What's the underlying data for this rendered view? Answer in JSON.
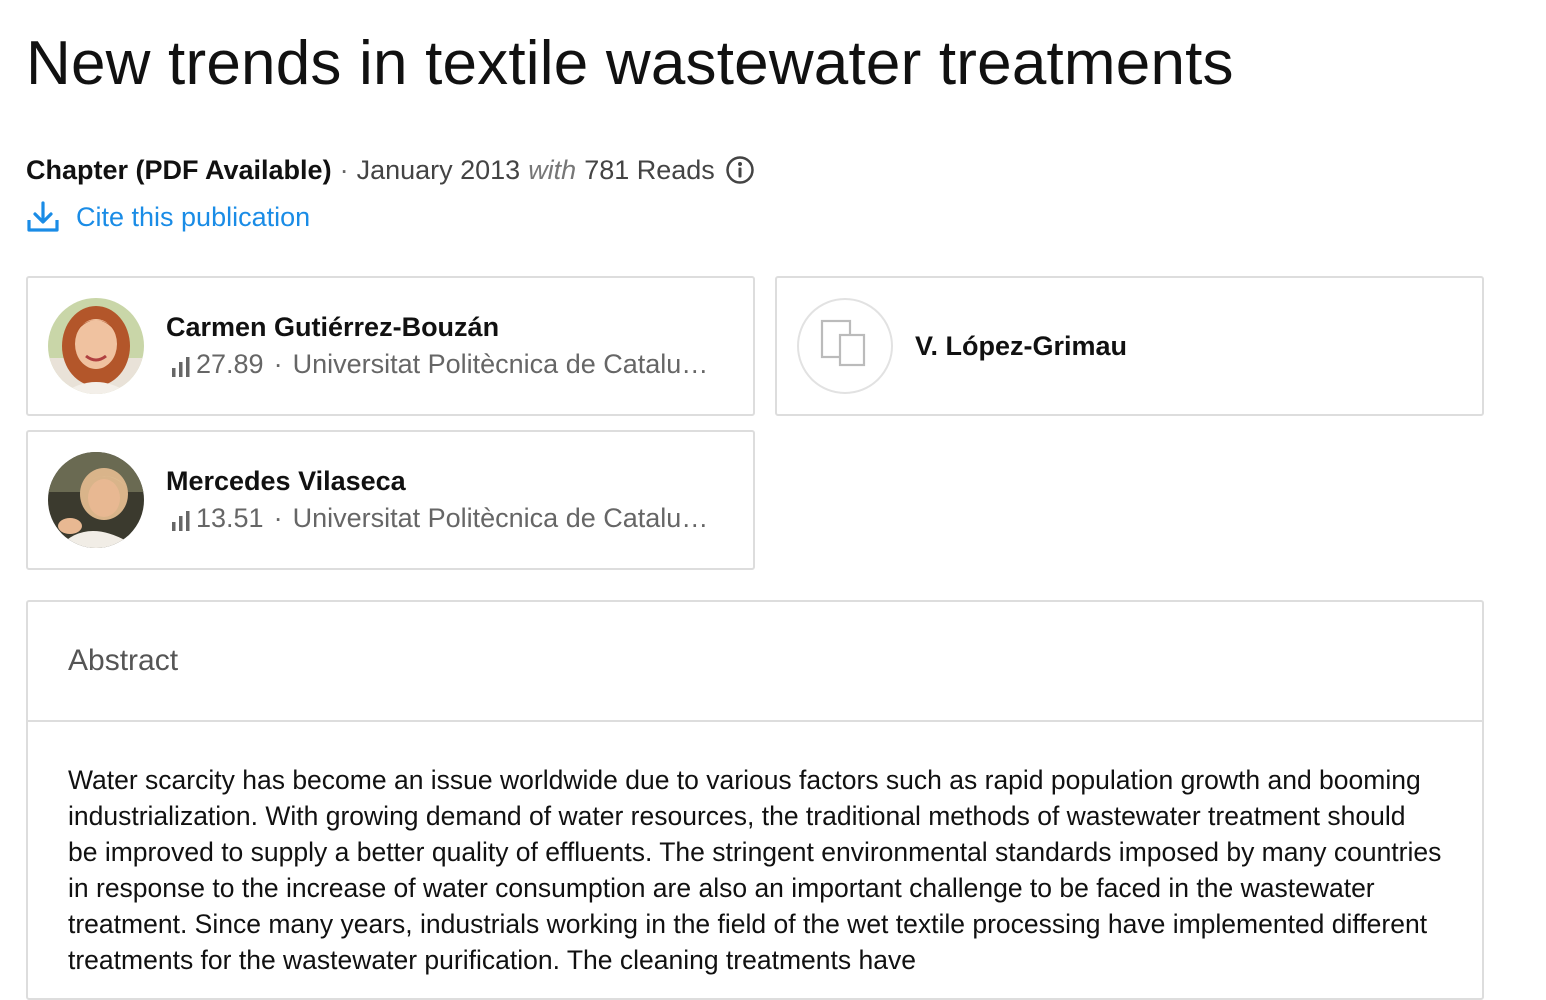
{
  "publication": {
    "title": "New trends in textile wastewater treatments",
    "type": "Chapter (PDF Available)",
    "separator": "·",
    "date": "January 2013",
    "with_word": "with",
    "reads": "781 Reads",
    "info_icon": "info-circle-icon",
    "cite_label": "Cite this publication",
    "cite_icon": "download-icon",
    "accent_color": "#1a8ce6"
  },
  "authors": [
    {
      "name": "Carmen Gutiérrez-Bouzán",
      "score": "27.89",
      "institution": "Universitat Politècnica de Catalunya",
      "has_photo": true
    },
    {
      "name": "V. López-Grimau",
      "has_photo": false
    },
    {
      "name": "Mercedes Vilaseca",
      "score": "13.51",
      "institution": "Universitat Politècnica de Catalunya",
      "has_photo": true
    }
  ],
  "abstract": {
    "heading": "Abstract",
    "text": "Water scarcity has become an issue worldwide due to various factors such as rapid population growth and booming industrialization. With growing demand of water resources, the traditional methods of wastewater treatment should be improved to supply a better quality of effluents. The stringent environmental standards imposed by many countries in response to the increase of water consumption are also an important challenge to be faced in the wastewater treatment. Since many years, industrials working in the field of the wet textile processing have implemented different treatments for the wastewater purification. The cleaning treatments have"
  }
}
